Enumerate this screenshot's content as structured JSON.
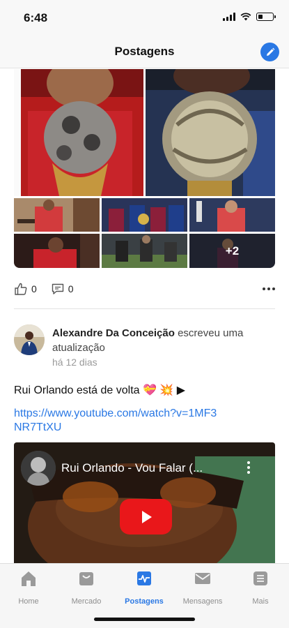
{
  "status_bar": {
    "time": "6:48"
  },
  "nav": {
    "title": "Postagens",
    "compose_icon": "pencil-icon"
  },
  "colors": {
    "accent": "#2a78e4",
    "youtube_red": "#e9171a",
    "muted": "#9a9a9a"
  },
  "previous_post": {
    "gallery_more_count": "+2",
    "likes": "0",
    "comments": "0"
  },
  "post": {
    "author": "Alexandre Da Conceição",
    "action": " escreveu uma atualização",
    "time": "há 12 dias",
    "text": "Rui Orlando está  de volta 💝 💥 ▶",
    "link": "https://www.youtube.com/watch?v=1MF3NR7TtXU",
    "video": {
      "title": "Rui Orlando - Vou Falar (..."
    }
  },
  "tabs": [
    {
      "label": "Home",
      "icon": "home-icon",
      "active": false
    },
    {
      "label": "Mercado",
      "icon": "shop-icon",
      "active": false
    },
    {
      "label": "Postagens",
      "icon": "activity-icon",
      "active": true
    },
    {
      "label": "Mensagens",
      "icon": "mail-icon",
      "active": false
    },
    {
      "label": "Mais",
      "icon": "menu-list-icon",
      "active": false
    }
  ]
}
